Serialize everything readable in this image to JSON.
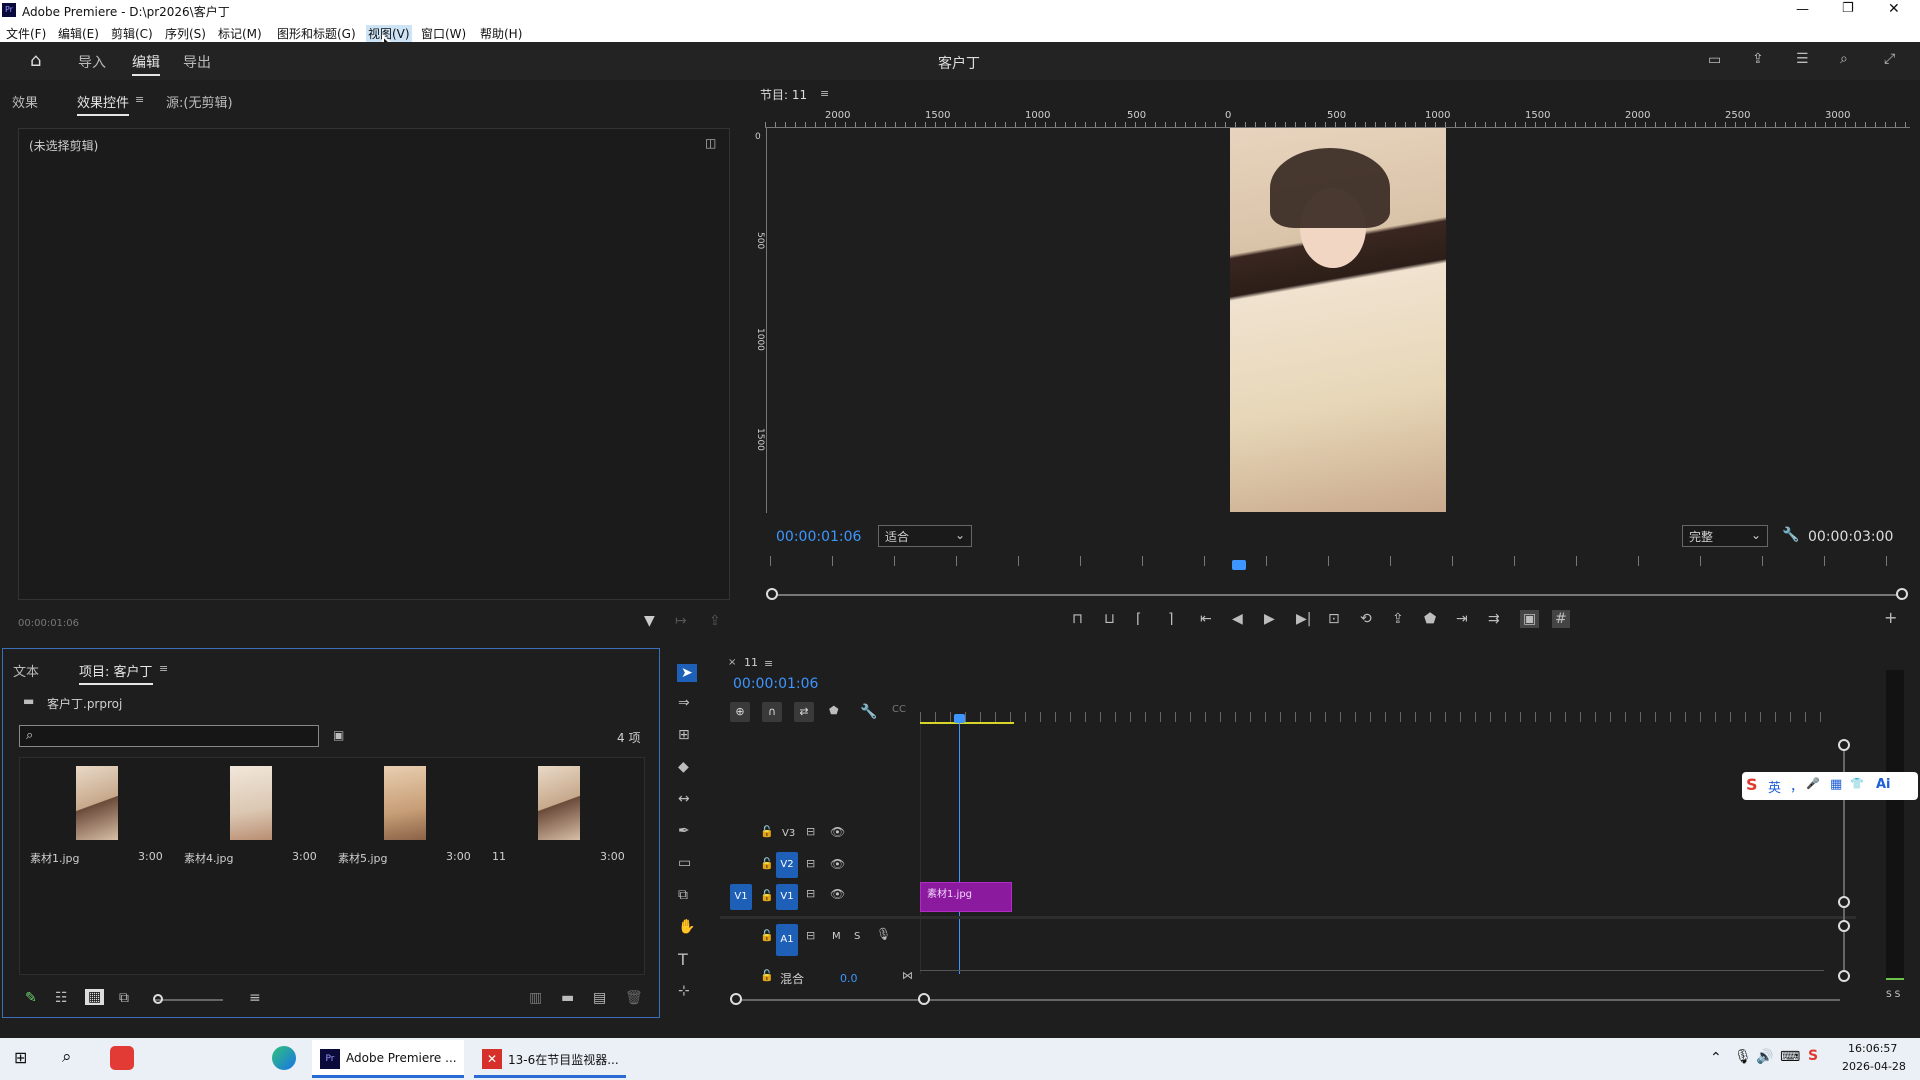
{
  "window": {
    "title": "Adobe Premiere - D:\\pr2026\\客户丁",
    "app_icon": "Pr"
  },
  "menu": [
    "文件(F)",
    "编辑(E)",
    "剪辑(C)",
    "序列(S)",
    "标记(M)",
    "图形和标题(G)",
    "视图(V)",
    "窗口(W)",
    "帮助(H)"
  ],
  "appbar": {
    "tabs": [
      "导入",
      "编辑",
      "导出"
    ],
    "active": "编辑",
    "project_title": "客户丁"
  },
  "effects_panel": {
    "tabs": [
      "效果",
      "效果控件",
      "源:(无剪辑)"
    ],
    "no_clip": "(未选择剪辑)",
    "timecode": "00:00:01:06"
  },
  "program": {
    "label": "节目: 11",
    "ruler_h": [
      "2000",
      "1500",
      "1000",
      "500",
      "0",
      "500",
      "1000",
      "1500",
      "2000",
      "2500",
      "3000"
    ],
    "ruler_v": [
      "0",
      "500",
      "1000",
      "1500"
    ],
    "timecode": "00:00:01:06",
    "fit": "适合",
    "quality": "完整",
    "duration": "00:00:03:00"
  },
  "project_panel": {
    "tabs": [
      "文本",
      "项目: 客户丁"
    ],
    "project_file": "客户丁.prproj",
    "search_placeholder": "",
    "count": "4 项",
    "items": [
      {
        "name": "素材1.jpg",
        "duration": "3:00"
      },
      {
        "name": "素材4.jpg",
        "duration": "3:00"
      },
      {
        "name": "素材5.jpg",
        "duration": "3:00"
      },
      {
        "name": "11",
        "duration": "3:00"
      }
    ]
  },
  "timeline": {
    "seq_tab": "11",
    "timecode": "00:00:01:06",
    "tracks": [
      "V3",
      "V2",
      "V1",
      "A1"
    ],
    "source_v1": "V1",
    "mix_label": "混合",
    "mix_value": "0.0",
    "clip": "素材1.jpg",
    "audio_M": "M",
    "audio_S": "S"
  },
  "meter": {
    "labels": "S S"
  },
  "ime": {
    "items": [
      "英",
      "，",
      "🎤",
      "▦",
      "👕",
      "Ai"
    ]
  },
  "taskbar": {
    "apps": [
      "Adobe Premiere ...",
      "13-6在节目监视器..."
    ],
    "time": "16:06:57",
    "date": "2026-04-28"
  },
  "colors": {
    "accent": "#3d96ff",
    "clip": "#8b1a9e",
    "badge": "#1e5fb8"
  }
}
